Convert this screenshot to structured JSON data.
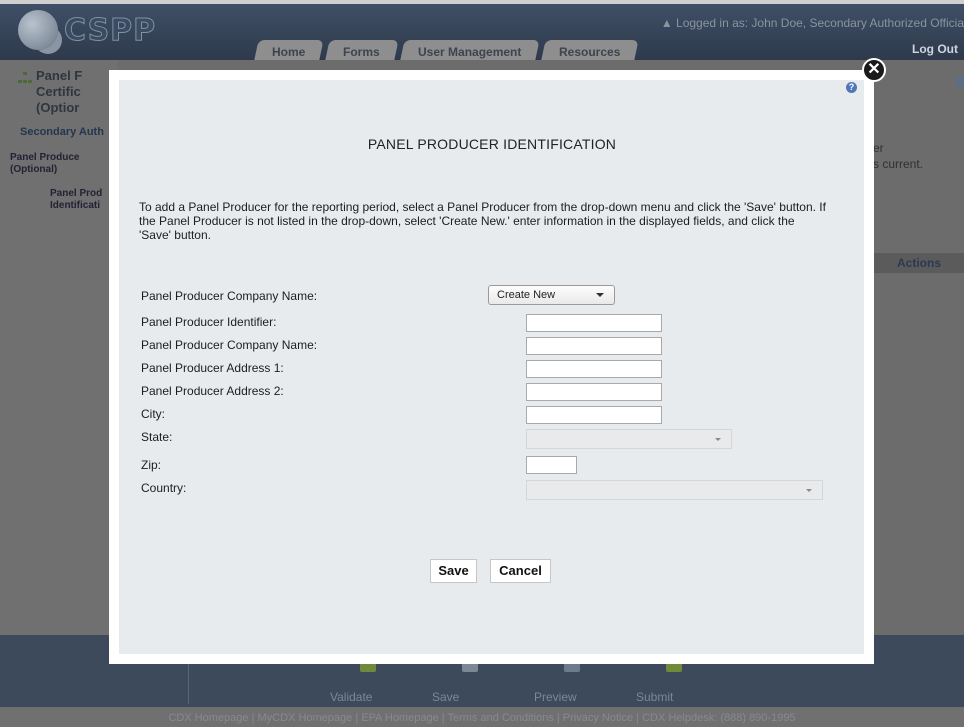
{
  "header": {
    "logo_text": "CSPP",
    "logged_in": "Logged in as: John Doe, Secondary Authorized Officia",
    "logout": "Log Out",
    "tabs": [
      "Home",
      "Forms",
      "User Management",
      "Resources"
    ]
  },
  "left_panel": {
    "title": "Panel F\nCertific\n(Optior",
    "section": "Secondary Auth",
    "tree_item_1": "Panel Produce\n(Optional)",
    "tree_item_2": "Panel Prod\nIdentificati"
  },
  "background": {
    "right_text": "er\ns current.",
    "actions_header": "Actions"
  },
  "bottom_bar": {
    "items": [
      "Validate",
      "Save",
      "Preview",
      "Submit"
    ]
  },
  "footer": {
    "text": "CDX Homepage  |  MyCDX Homepage  |  EPA Homepage  |  Terms and Conditions  |  Privacy Notice  |  CDX Helpdesk: (888) 890-1995"
  },
  "modal": {
    "close_symbol": "✕",
    "help_symbol": "?",
    "title": "PANEL PRODUCER IDENTIFICATION",
    "instructions": "To add a Panel Producer for the reporting period, select a Panel Producer from the drop-down menu and click the 'Save' button. If the Panel Producer is not listed in the drop-down, select 'Create New.' enter information in the displayed fields, and click the 'Save' button.",
    "fields": {
      "company_select_label": "Panel Producer Company Name:",
      "company_select_value": "Create New",
      "identifier_label": "Panel Producer Identifier:",
      "identifier_value": "",
      "company_name_label": "Panel Producer Company Name:",
      "company_name_value": "",
      "address1_label": "Panel Producer Address 1:",
      "address1_value": "",
      "address2_label": "Panel Producer Address 2:",
      "address2_value": "",
      "city_label": "City:",
      "city_value": "",
      "state_label": "State:",
      "state_value": "",
      "zip_label": "Zip:",
      "zip_value": "",
      "country_label": "Country:",
      "country_value": ""
    },
    "buttons": {
      "save": "Save",
      "cancel": "Cancel"
    }
  }
}
